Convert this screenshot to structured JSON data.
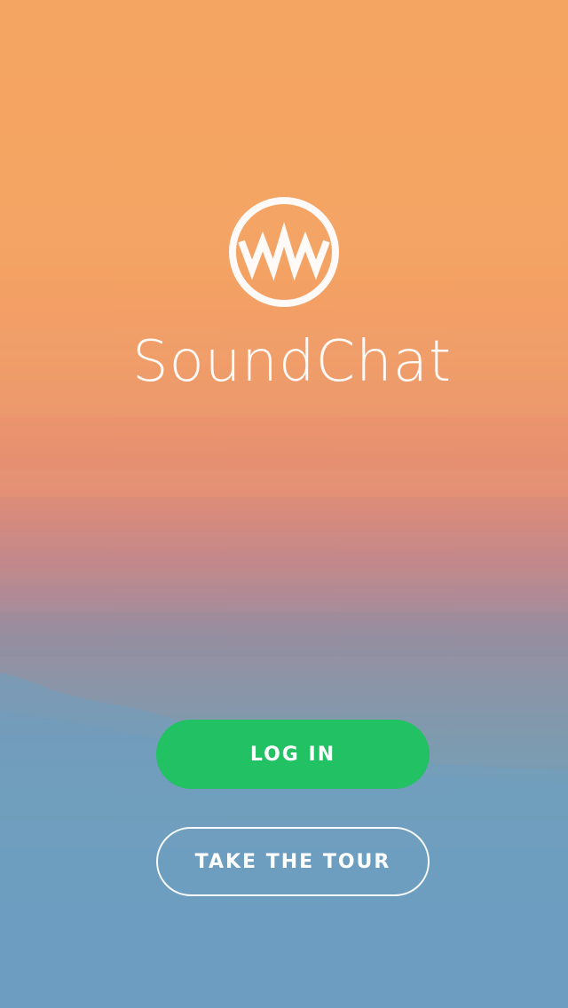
{
  "app": {
    "name": "SoundChat",
    "logo_icon": "soundwave-circle-logo"
  },
  "actions": {
    "login_label": "LOG IN",
    "tour_label": "TAKE THE TOUR"
  },
  "colors": {
    "login_button": "#21c164",
    "text": "#ffffff",
    "sky_top": "#f4a562",
    "sky_bottom": "#6a9ec3"
  }
}
